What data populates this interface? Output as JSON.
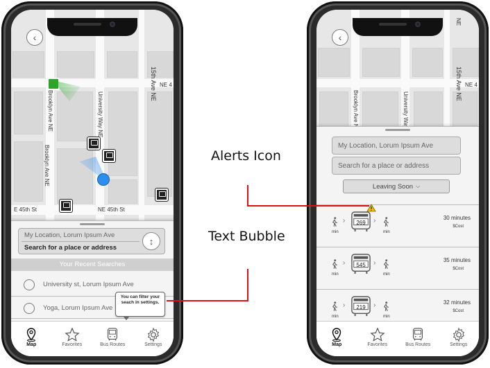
{
  "left_screen": {
    "streets": {
      "brooklyn_top": "Brooklyn Ave NE",
      "brooklyn_bottom": "Brooklyn Ave NE",
      "university": "University Way NE",
      "fifteenth": "15th Ave NE",
      "ne4": "NE 4",
      "ne45_left": "E 45th St",
      "ne45_right": "NE 45th St"
    },
    "search": {
      "current_location": "My Location, Lorum Ipsum Ave",
      "destination_placeholder": "Search for a place or address"
    },
    "recent_header": "Your Recent Searches",
    "recent": [
      {
        "label": "University st, Lorum Ipsum Ave"
      },
      {
        "label": "Yoga, Lorum Ipsum Ave"
      }
    ],
    "bubble": "You can filter your seach in settings."
  },
  "right_screen": {
    "streets": {
      "brooklyn": "Brooklyn Ave NE",
      "university": "University Way NE",
      "fifteenth": "15th Ave NE",
      "ne4": "NE 4",
      "top_right": "NE"
    },
    "search": {
      "current_location": "My Location, Lorum Ipsum Ave",
      "destination_placeholder": "Search for a place or address"
    },
    "filter_label": "Leaving Soon",
    "routes": [
      {
        "bus": "269",
        "duration": "30 minutes",
        "cost": "$Cost",
        "alert": true
      },
      {
        "bus": "545",
        "duration": "35 minutes",
        "cost": "$Cost",
        "alert": false
      },
      {
        "bus": "219",
        "duration": "32 minutes",
        "cost": "$Cost",
        "alert": false
      }
    ],
    "min_label": "min"
  },
  "tabs": [
    {
      "label": "Map",
      "icon": "map-pin-icon"
    },
    {
      "label": "Favorites",
      "icon": "star-icon"
    },
    {
      "label": "Bus Routes",
      "icon": "bus-icon"
    },
    {
      "label": "Settings",
      "icon": "gear-icon"
    }
  ],
  "annotations": {
    "alerts_icon": "Alerts Icon",
    "text_bubble": "Text Bubble"
  },
  "colors": {
    "accent_green": "#2aa52a",
    "location_blue": "#2b8ef0",
    "alert_yellow": "#f2c200",
    "annotation_red": "#dd1111"
  }
}
